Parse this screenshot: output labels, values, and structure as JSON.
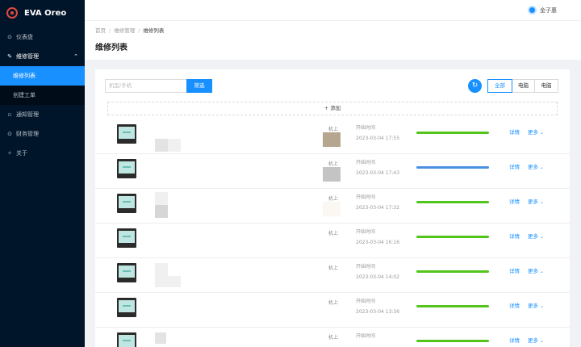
{
  "app": {
    "name": "EVA Oreo"
  },
  "topbar": {
    "username": "金子惠"
  },
  "sidebar": {
    "items": [
      {
        "icon": "dashboard-icon",
        "glyph": "⊙",
        "label": "仪表盘"
      },
      {
        "icon": "wrench-icon",
        "glyph": "✎",
        "label": "维修管理",
        "expanded": true,
        "children": [
          {
            "label": "维修列表",
            "active": true
          },
          {
            "label": "创建工单",
            "active": false
          }
        ]
      },
      {
        "icon": "notice-icon",
        "glyph": "▫",
        "label": "通知管理"
      },
      {
        "icon": "finance-icon",
        "glyph": "⊙",
        "label": "财务管理"
      },
      {
        "icon": "about-icon",
        "glyph": "✧",
        "label": "关于"
      }
    ]
  },
  "breadcrumb": [
    "首页",
    "维修管理",
    "维修列表"
  ],
  "page": {
    "title": "维修列表"
  },
  "filter": {
    "placeholder": "机型/手机",
    "button": "筛选"
  },
  "segment": {
    "options": [
      "全部",
      "电脑",
      "电脑"
    ],
    "selected": 0
  },
  "add_label": "+ 添加",
  "list": {
    "tag_label": "机上",
    "start_label": "开始时间",
    "detail_label": "详情",
    "more_label": "更多",
    "rows": [
      {
        "time": "2023-03-04 17:55",
        "progress": 1.0,
        "color": "#52c41a"
      },
      {
        "time": "2023-03-04 17:43",
        "progress": 1.0,
        "color": "#4a90e2"
      },
      {
        "time": "2023-03-04 17:32",
        "progress": 1.0,
        "color": "#52c41a"
      },
      {
        "time": "2023-03-04 16:16",
        "progress": 1.0,
        "color": "#52c41a"
      },
      {
        "time": "2023-03-04 14:02",
        "progress": 1.0,
        "color": "#52c41a"
      },
      {
        "time": "2023-03-04 13:36",
        "progress": 1.0,
        "color": "#52c41a"
      },
      {
        "time": "",
        "progress": 1.0,
        "color": "#52c41a"
      }
    ]
  }
}
